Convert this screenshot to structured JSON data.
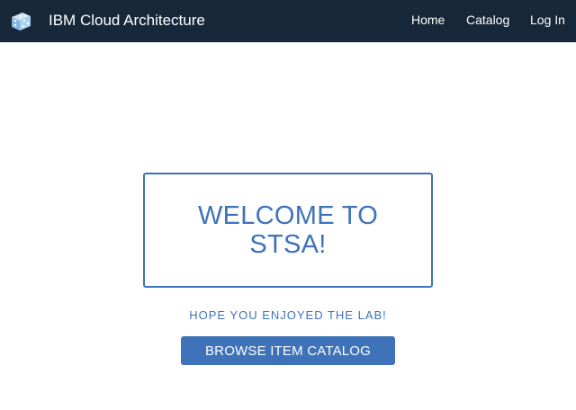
{
  "navbar": {
    "logo_icon": "cloud-cube-logo-icon",
    "brand": "IBM Cloud Architecture",
    "links": {
      "home": "Home",
      "catalog": "Catalog",
      "login": "Log In"
    },
    "background_color": "#17283a"
  },
  "main": {
    "welcome_title_line1": "WELCOME TO",
    "welcome_title_line2": "STSA!",
    "subtitle": "HOPE YOU ENJOYED THE LAB!",
    "browse_button": "BROWSE ITEM CATALOG",
    "accent_color": "#3e73b9"
  }
}
